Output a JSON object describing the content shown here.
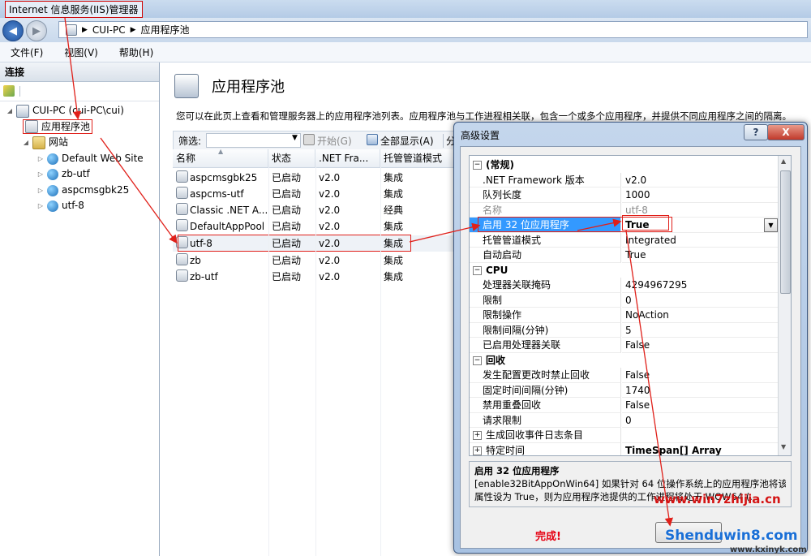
{
  "window": {
    "title": "Internet 信息服务(IIS)管理器"
  },
  "address": {
    "segments": [
      "CUI-PC",
      "应用程序池"
    ]
  },
  "menu": {
    "items": [
      "文件(F)",
      "视图(V)",
      "帮助(H)"
    ]
  },
  "connections": {
    "header": "连接",
    "tree": [
      {
        "label": "CUI-PC (cui-PC\\cui)",
        "level": 0,
        "icon": "server-icon"
      },
      {
        "label": "应用程序池",
        "level": 1,
        "icon": "app-pool-icon"
      },
      {
        "label": "网站",
        "level": 1,
        "icon": "sites-folder-icon"
      },
      {
        "label": "Default Web Site",
        "level": 2,
        "icon": "globe-icon"
      },
      {
        "label": "zb-utf",
        "level": 2,
        "icon": "globe-icon"
      },
      {
        "label": "aspcmsgbk25",
        "level": 2,
        "icon": "globe-icon"
      },
      {
        "label": "utf-8",
        "level": 2,
        "icon": "globe-icon"
      }
    ]
  },
  "main": {
    "title": "应用程序池",
    "description": "您可以在此页上查看和管理服务器上的应用程序池列表。应用程序池与工作进程相关联，包含一个或多个应用程序，并提供不同应用程序之间的隔离。",
    "toolbar": {
      "filter_label": "筛选:",
      "start_label": "开始(G)",
      "show_all_label": "全部显示(A)",
      "group_label": "分"
    },
    "columns": [
      "名称",
      "状态",
      ".NET Fra...",
      "托管管道模式"
    ],
    "pools": [
      {
        "name": "aspcmsgbk25",
        "status": "已启动",
        "net": "v2.0",
        "mode": "集成"
      },
      {
        "name": "aspcms-utf",
        "status": "已启动",
        "net": "v2.0",
        "mode": "集成"
      },
      {
        "name": "Classic .NET A...",
        "status": "已启动",
        "net": "v2.0",
        "mode": "经典"
      },
      {
        "name": "DefaultAppPool",
        "status": "已启动",
        "net": "v2.0",
        "mode": "集成"
      },
      {
        "name": "utf-8",
        "status": "已启动",
        "net": "v2.0",
        "mode": "集成"
      },
      {
        "name": "zb",
        "status": "已启动",
        "net": "v2.0",
        "mode": "集成"
      },
      {
        "name": "zb-utf",
        "status": "已启动",
        "net": "v2.0",
        "mode": "集成"
      }
    ]
  },
  "dialog": {
    "title": "高级设置",
    "help_label": "?",
    "close_label": "X",
    "categories": [
      {
        "name": "(常规)",
        "rows": [
          {
            "name": ".NET Framework 版本",
            "value": "v2.0"
          },
          {
            "name": "队列长度",
            "value": "1000"
          },
          {
            "name": "名称",
            "value": "utf-8"
          },
          {
            "name": "启用 32 位应用程序",
            "value": "True"
          },
          {
            "name": "托管管道模式",
            "value": "Integrated"
          },
          {
            "name": "自动启动",
            "value": "True"
          }
        ]
      },
      {
        "name": "CPU",
        "rows": [
          {
            "name": "处理器关联掩码",
            "value": "4294967295"
          },
          {
            "name": "限制",
            "value": "0"
          },
          {
            "name": "限制操作",
            "value": "NoAction"
          },
          {
            "name": "限制间隔(分钟)",
            "value": "5"
          },
          {
            "name": "已启用处理器关联",
            "value": "False"
          }
        ]
      },
      {
        "name": "回收",
        "rows": [
          {
            "name": "发生配置更改时禁止回收",
            "value": "False"
          },
          {
            "name": "固定时间间隔(分钟)",
            "value": "1740"
          },
          {
            "name": "禁用重叠回收",
            "value": "False"
          },
          {
            "name": "请求限制",
            "value": "0"
          },
          {
            "name": "生成回收事件日志条目",
            "value": ""
          },
          {
            "name": "特定时间",
            "value": "TimeSpan[] Array"
          }
        ]
      }
    ],
    "desc_title": "启用 32 位应用程序",
    "desc_line1": "[enable32BitAppOnWin64] 如果针对 64 位操作系统上的应用程序池将该",
    "desc_line2": "属性设为 True，则为应用程序池提供的工作进程将处于 WOW64 (...",
    "ok_annotation": "完成!"
  },
  "watermarks": {
    "site1": "www.win7zhijia.cn",
    "site2": "Shenduwin8.com",
    "site3": "www.kxinyk.com"
  },
  "colors": {
    "annotation_red": "#e0201a",
    "accent_blue": "#1b4f9c"
  }
}
